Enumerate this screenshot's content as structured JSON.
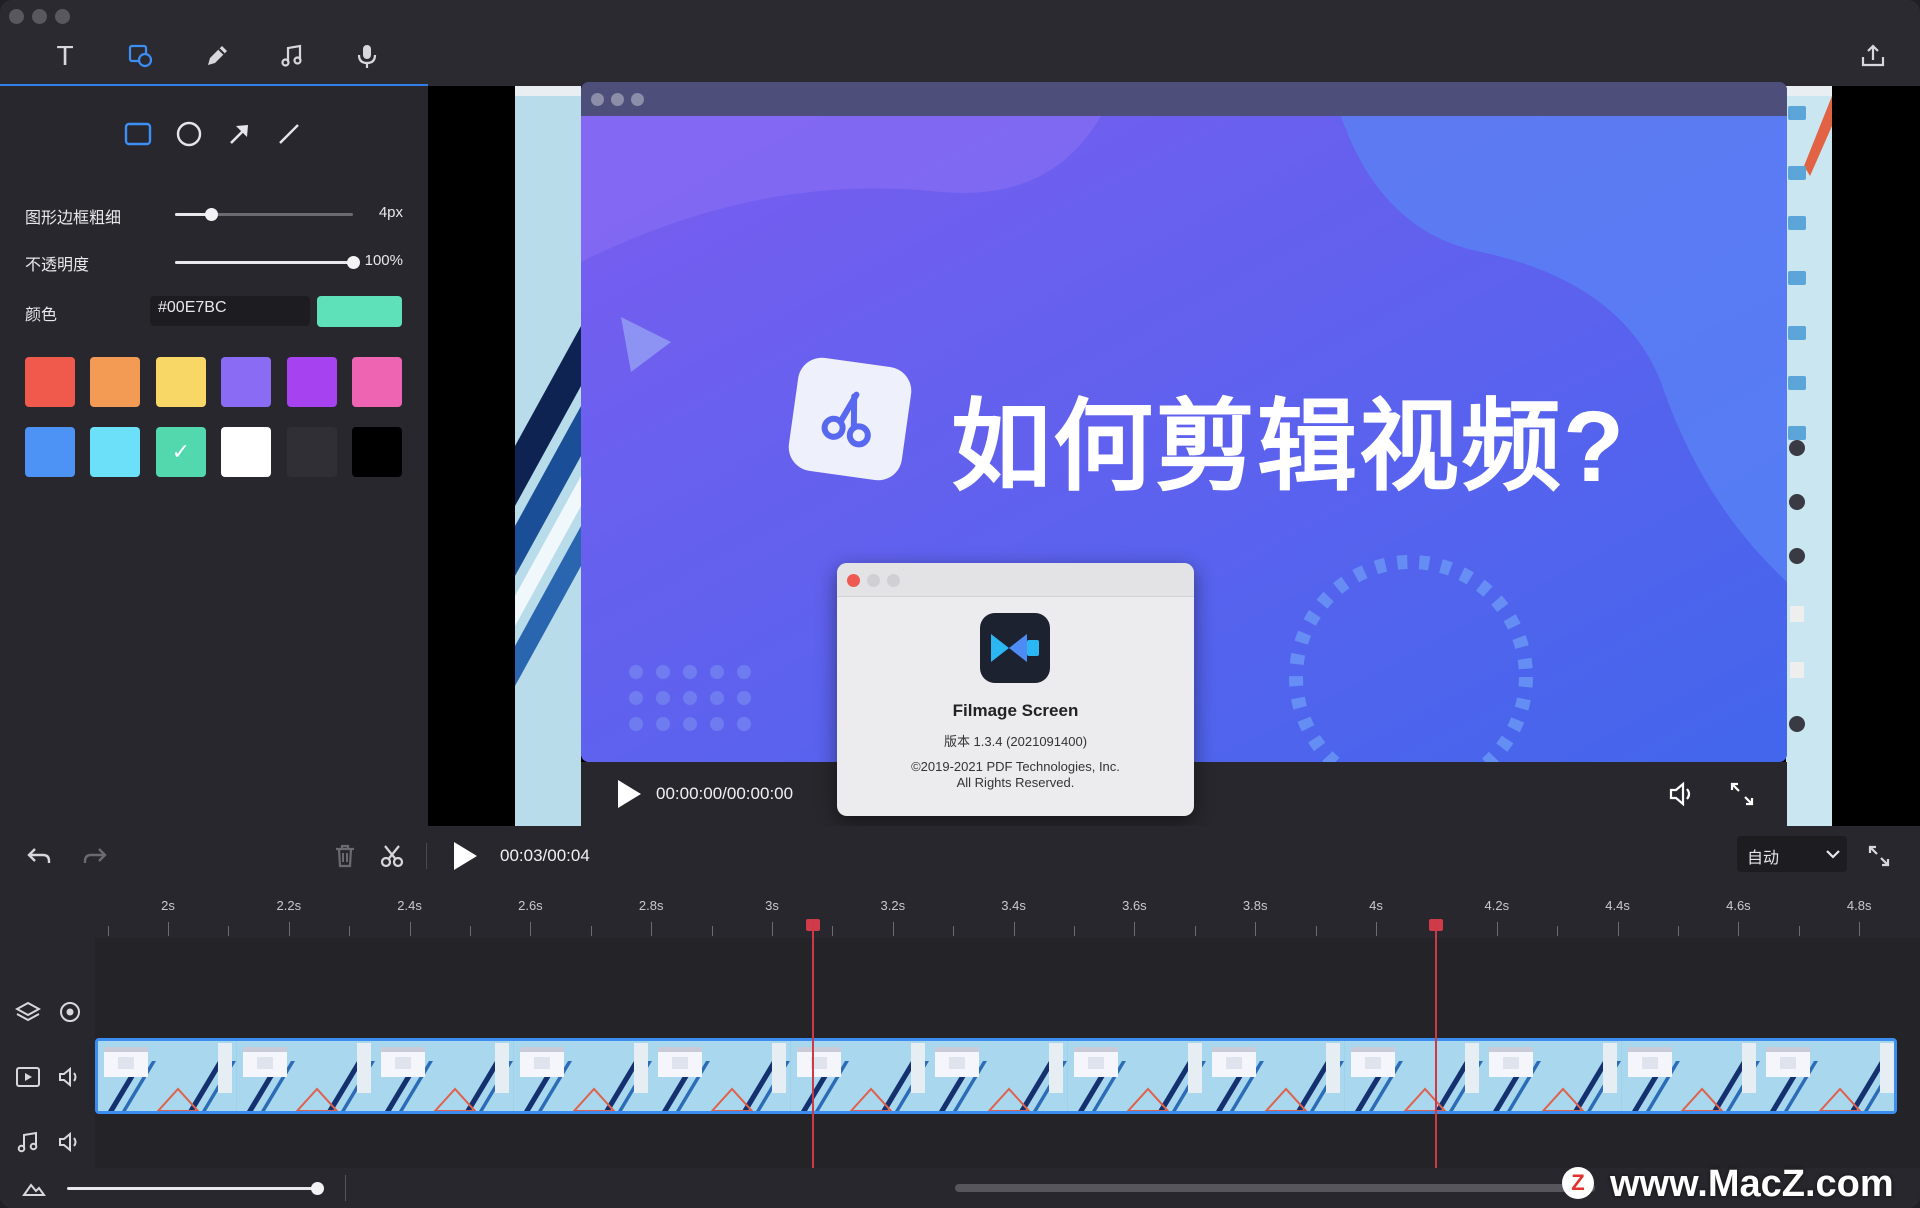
{
  "toolbar": {
    "tools": [
      {
        "name": "text",
        "icon": "text-icon",
        "label": "T"
      },
      {
        "name": "shape",
        "icon": "shape-icon"
      },
      {
        "name": "pen",
        "icon": "pen-icon"
      },
      {
        "name": "music",
        "icon": "music-icon"
      },
      {
        "name": "mic",
        "icon": "microphone-icon"
      }
    ],
    "export_icon": "export-icon"
  },
  "sidebar": {
    "shapes": [
      "rectangle-icon",
      "circle-icon",
      "arrow-icon",
      "line-icon"
    ],
    "border_label": "图形边框粗细",
    "border_value": "4px",
    "border_level": 0.2,
    "opacity_label": "不透明度",
    "opacity_value": "100%",
    "opacity_level": 1.0,
    "color_label": "颜色",
    "color_hex": "#00E7BC",
    "color_preview": "#5ee0b8",
    "swatches": [
      "#ef5a4c",
      "#f39b55",
      "#f9d767",
      "#8a6cf4",
      "#a742f0",
      "#ee64b3",
      "#4c93f5",
      "#6ce0f8",
      "#53d7ad",
      "#ffffff",
      "#2f2f35",
      "#000000"
    ],
    "selected_swatch": 8,
    "check_mark": "✓"
  },
  "preview": {
    "title": "如何剪辑视频?",
    "timecode": "00:00:00/00:00:00",
    "about": {
      "app_name": "Filmage Screen",
      "version": "版本 1.3.4 (2021091400)",
      "copyright_line1": "©2019-2021 PDF Technologies, Inc.",
      "copyright_line2": "All Rights Reserved."
    }
  },
  "edit": {
    "timecode": "00:03/00:04",
    "quality": "自动"
  },
  "ruler": {
    "labels": [
      "2s",
      "2.2s",
      "2.4s",
      "2.6s",
      "2.8s",
      "3s",
      "3.2s",
      "3.4s",
      "3.6s",
      "3.8s",
      "4s",
      "4.2s",
      "4.4s",
      "4.6s",
      "4.8s"
    ]
  },
  "watermark": {
    "text": "www.MacZ.com",
    "logo": "Z"
  },
  "colors": {
    "accent": "#3d8ef5",
    "playhead": "#cc3a47",
    "panel": "#27272d"
  }
}
